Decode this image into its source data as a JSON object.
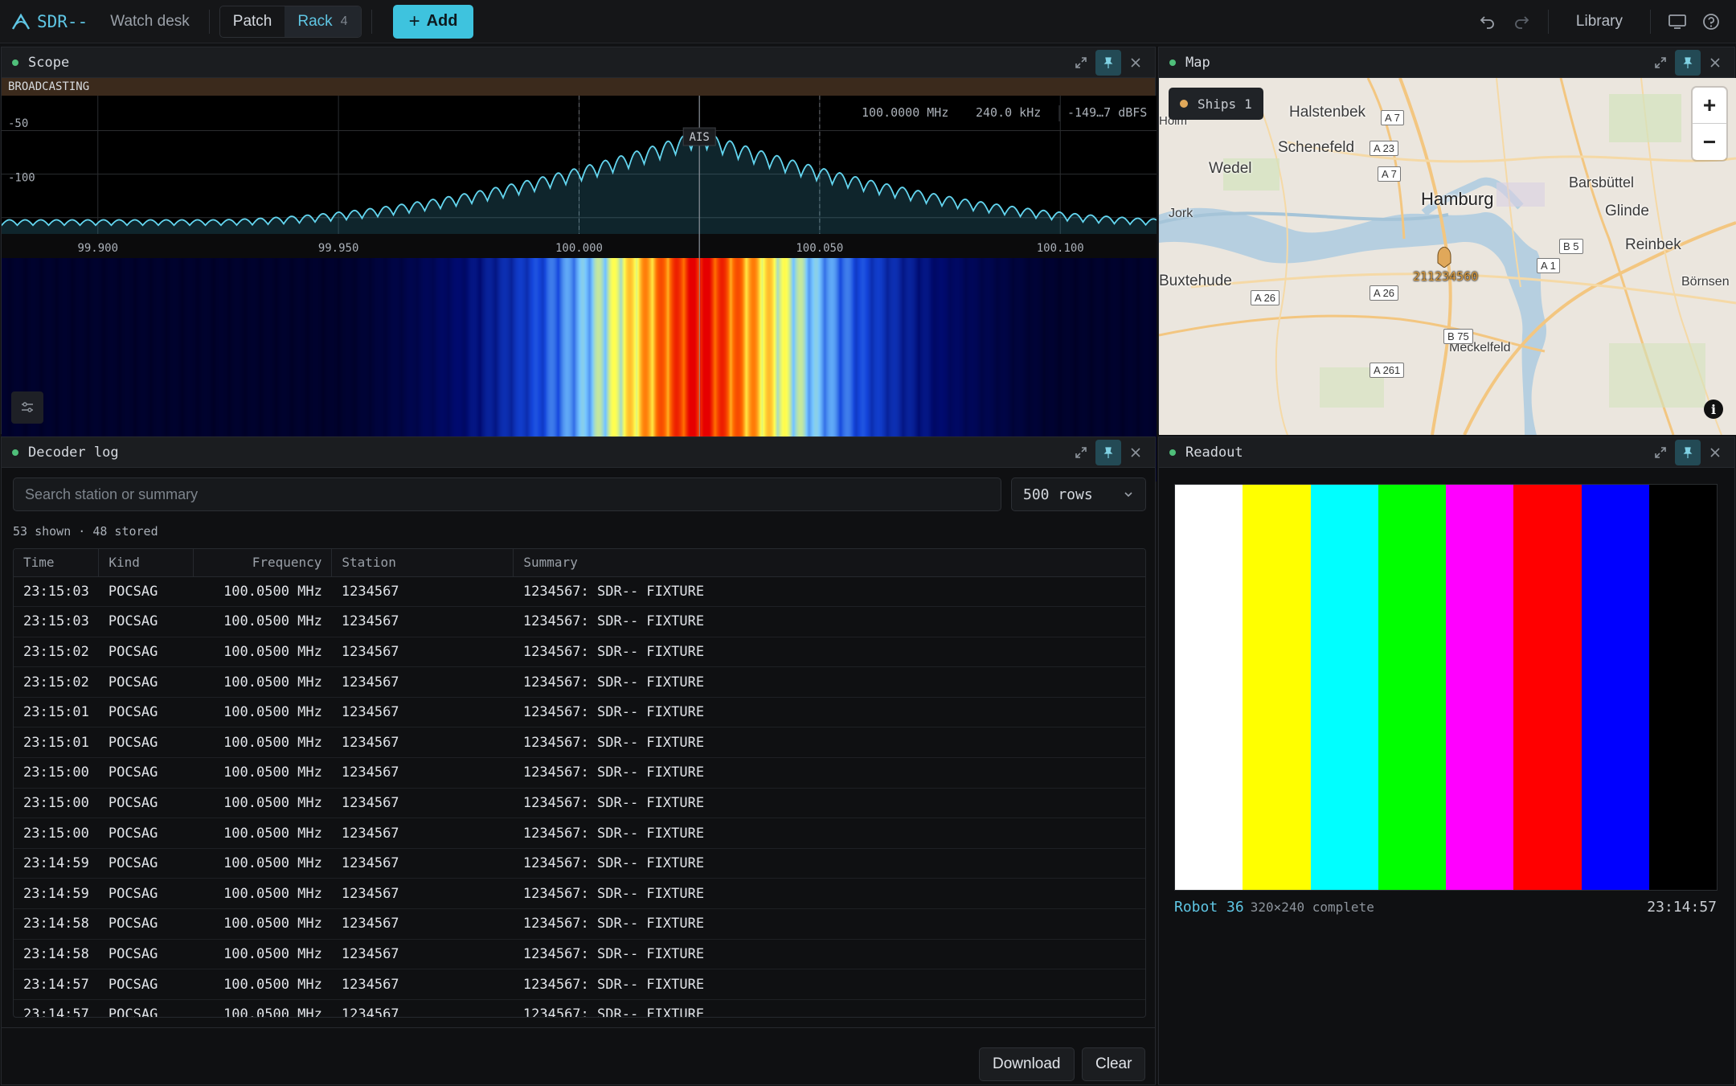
{
  "app": {
    "name": "SDR--",
    "desk": "Watch desk"
  },
  "toolbar": {
    "patch_label": "Patch",
    "rack_label": "Rack",
    "rack_count": "4",
    "add_label": "Add",
    "library_label": "Library"
  },
  "scope": {
    "title": "Scope",
    "status": "BROADCASTING",
    "readout_freq": "100.0000 MHz",
    "readout_bw": "240.0 kHz",
    "readout_level": "-149…7 dBFS",
    "marker_label": "AIS",
    "y_ticks": [
      "-50",
      "-100"
    ],
    "x_ticks": [
      "99.900",
      "99.950",
      "100.000",
      "100.050",
      "100.100"
    ],
    "chart_data": {
      "type": "line",
      "x_ticks": [
        99.9,
        99.95,
        100.0,
        100.05,
        100.1
      ],
      "x_range": [
        99.88,
        100.12
      ],
      "y_ticks": [
        -50,
        -100
      ],
      "center_mhz": 100.0,
      "marker_mhz": 100.025,
      "passband_mhz": [
        100.0,
        100.05
      ],
      "peak_dbfs": -45,
      "floor_dbfs": -150
    }
  },
  "map": {
    "title": "Map",
    "ships_label": "Ships",
    "ships_count": "1",
    "ship_id": "211234560",
    "places": [
      "Halstenbek",
      "Schenefeld",
      "Wedel",
      "Hamburg",
      "Barsbüttel",
      "Glinde",
      "Jork",
      "Reinbek",
      "Buxtehude",
      "Börnsen",
      "Meckelfeld",
      "Holm"
    ],
    "roads": [
      "A 7",
      "A 23",
      "A 7",
      "B 5",
      "A 1",
      "A 26",
      "A 26",
      "B 75",
      "A 261"
    ]
  },
  "decoder": {
    "title": "Decoder log",
    "search_placeholder": "Search station or summary",
    "rows_option": "500 rows",
    "meta": "53 shown · 48 stored",
    "columns": [
      "Time",
      "Kind",
      "Frequency",
      "Station",
      "Summary"
    ],
    "rows": [
      [
        "23:15:03",
        "POCSAG",
        "100.0500 MHz",
        "1234567",
        "1234567: SDR-- FIXTURE"
      ],
      [
        "23:15:03",
        "POCSAG",
        "100.0500 MHz",
        "1234567",
        "1234567: SDR-- FIXTURE"
      ],
      [
        "23:15:02",
        "POCSAG",
        "100.0500 MHz",
        "1234567",
        "1234567: SDR-- FIXTURE"
      ],
      [
        "23:15:02",
        "POCSAG",
        "100.0500 MHz",
        "1234567",
        "1234567: SDR-- FIXTURE"
      ],
      [
        "23:15:01",
        "POCSAG",
        "100.0500 MHz",
        "1234567",
        "1234567: SDR-- FIXTURE"
      ],
      [
        "23:15:01",
        "POCSAG",
        "100.0500 MHz",
        "1234567",
        "1234567: SDR-- FIXTURE"
      ],
      [
        "23:15:00",
        "POCSAG",
        "100.0500 MHz",
        "1234567",
        "1234567: SDR-- FIXTURE"
      ],
      [
        "23:15:00",
        "POCSAG",
        "100.0500 MHz",
        "1234567",
        "1234567: SDR-- FIXTURE"
      ],
      [
        "23:15:00",
        "POCSAG",
        "100.0500 MHz",
        "1234567",
        "1234567: SDR-- FIXTURE"
      ],
      [
        "23:14:59",
        "POCSAG",
        "100.0500 MHz",
        "1234567",
        "1234567: SDR-- FIXTURE"
      ],
      [
        "23:14:59",
        "POCSAG",
        "100.0500 MHz",
        "1234567",
        "1234567: SDR-- FIXTURE"
      ],
      [
        "23:14:58",
        "POCSAG",
        "100.0500 MHz",
        "1234567",
        "1234567: SDR-- FIXTURE"
      ],
      [
        "23:14:58",
        "POCSAG",
        "100.0500 MHz",
        "1234567",
        "1234567: SDR-- FIXTURE"
      ],
      [
        "23:14:57",
        "POCSAG",
        "100.0500 MHz",
        "1234567",
        "1234567: SDR-- FIXTURE"
      ],
      [
        "23:14:57",
        "POCSAG",
        "100.0500 MHz",
        "1234567",
        "1234567: SDR-- FIXTURE"
      ]
    ],
    "download_label": "Download",
    "clear_label": "Clear"
  },
  "readout": {
    "title": "Readout",
    "mode": "Robot 36",
    "detail": "320×240 complete",
    "time": "23:14:57",
    "bar_colors": [
      "#ffffff",
      "#ffff00",
      "#00ffff",
      "#00ff00",
      "#ff00ff",
      "#ff0000",
      "#0000ff",
      "#000000"
    ]
  },
  "colors": {
    "accent": "#3ec3de",
    "live": "#4fbf7a",
    "broadcast_bg": "#3b2a1c",
    "ship": "#e0a85a"
  }
}
